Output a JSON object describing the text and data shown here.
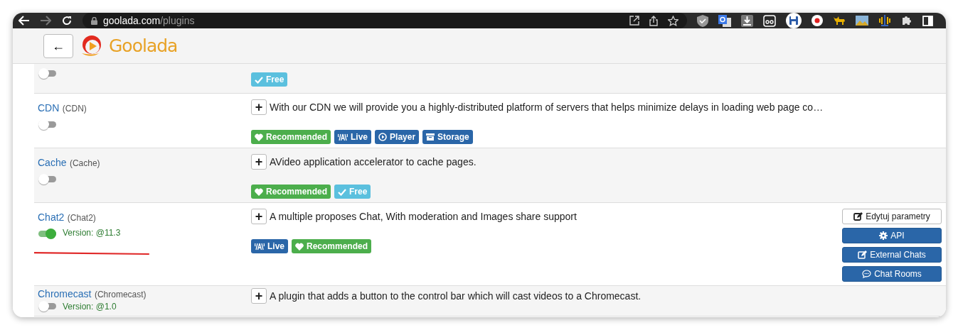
{
  "browser": {
    "url_host": "goolada.com",
    "url_path": "/plugins",
    "back_enabled": true,
    "forward_enabled": false
  },
  "header": {
    "back_label": "←",
    "logo_text": "Goolada"
  },
  "plugins": [
    {
      "enabled": false,
      "tags": [
        {
          "kind": "free",
          "label": "Free"
        }
      ]
    },
    {
      "name": "CDN",
      "id": "(CDN)",
      "enabled": false,
      "expand": "+",
      "description": "With our CDN we will provide you a highly-distributed platform of servers that helps minimize delays in loading web page co…",
      "tags": [
        {
          "kind": "recommended",
          "label": "Recommended"
        },
        {
          "kind": "live",
          "label": "Live"
        },
        {
          "kind": "player",
          "label": "Player"
        },
        {
          "kind": "storage",
          "label": "Storage"
        }
      ]
    },
    {
      "name": "Cache",
      "id": "(Cache)",
      "enabled": false,
      "expand": "+",
      "description": "AVideo application accelerator to cache pages.",
      "tags": [
        {
          "kind": "recommended",
          "label": "Recommended"
        },
        {
          "kind": "free",
          "label": "Free"
        }
      ]
    },
    {
      "name": "Chat2",
      "id": "(Chat2)",
      "enabled": true,
      "version": "Version: @11.3",
      "highlighted": true,
      "expand": "+",
      "description": "A multiple proposes Chat, With moderation and Images share support",
      "tags": [
        {
          "kind": "live",
          "label": "Live"
        },
        {
          "kind": "recommended",
          "label": "Recommended"
        }
      ],
      "actions": [
        {
          "kind": "edit",
          "label": "Edytuj parametry"
        },
        {
          "kind": "api",
          "label": "API"
        },
        {
          "kind": "external",
          "label": "External Chats"
        },
        {
          "kind": "rooms",
          "label": "Chat Rooms"
        }
      ]
    },
    {
      "name": "Chromecast",
      "id": "(Chromecast)",
      "enabled": false,
      "version": "Version: @1.0",
      "expand": "+",
      "description": "A plugin that adds a button to the control bar which will cast videos to a Chromecast."
    }
  ]
}
